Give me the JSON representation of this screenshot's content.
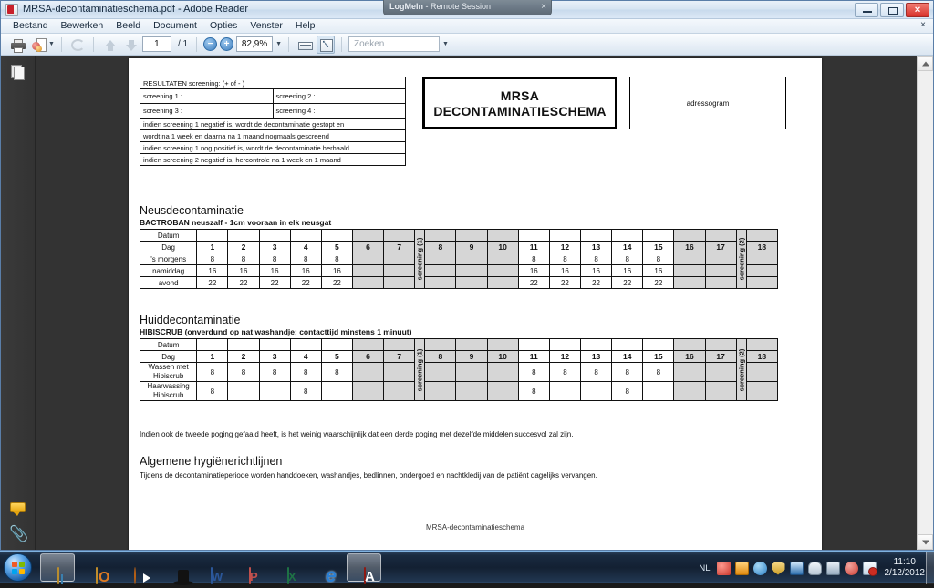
{
  "logmein": {
    "app": "LogMeIn",
    "suffix": " - Remote Session",
    "close": "×"
  },
  "window": {
    "title": "MRSA-decontaminatieschema.pdf - Adobe Reader",
    "minimize_label": "Minimaliseren",
    "maximize_label": "Maximaliseren",
    "close_label": "Sluiten"
  },
  "menubar": {
    "items": [
      "Bestand",
      "Bewerken",
      "Beeld",
      "Document",
      "Opties",
      "Venster",
      "Help"
    ],
    "close_doc": "×"
  },
  "toolbar": {
    "print_label": "Afdrukken",
    "share_label": "Verzenden",
    "rotate_label": "Draaien",
    "prev_label": "Vorige pagina",
    "next_label": "Volgende pagina",
    "page_current": "1",
    "page_total": "/ 1",
    "zoom_out": "−",
    "zoom_in": "+",
    "zoom_value": "82,9%",
    "zoom_caret": "▼",
    "fit_width_label": "Paginabreedte",
    "fit_page_label": "Volledige pagina",
    "search_placeholder": "Zoeken",
    "search_value": "",
    "search_caret": "▼"
  },
  "navrail": {
    "pages_label": "Paginaminiaturen",
    "comments_label": "Opmerkingen",
    "attachments_label": "Bijlagen",
    "clip_glyph": "📎"
  },
  "scrollbar": {
    "up": "▲",
    "down": "▼"
  },
  "document": {
    "results_table": {
      "title": "RESULTATEN screening: (+ of - )",
      "rows": [
        [
          "screening 1    :",
          "screening 2    :"
        ],
        [
          "screening 3    :",
          "screening 4    :"
        ]
      ],
      "notes": [
        "indien screening 1 negatief  is, wordt de decontaminatie gestopt en",
        "wordt na 1 week en daarna na 1 maand nogmaals gescreend",
        "indien screening 1 nog positief  is, wordt de decontaminatie herhaald",
        "indien screening 2 negatief is, hercontrole na 1 week en 1 maand"
      ]
    },
    "title_box": {
      "line1": "MRSA",
      "line2": "DECONTAMINATIESCHEMA"
    },
    "address_box": {
      "label": "adressogram"
    },
    "section_nose": {
      "heading": "Neusdecontaminatie",
      "subheading": "BACTROBAN neuszalf - 1cm vooraan in elk neusgat",
      "row_labels": {
        "datum": "Datum",
        "dag": "Dag",
        "r1": "'s morgens",
        "r2": "namiddag",
        "r3": "avond"
      },
      "screening1": "screening (1)",
      "screening2": "screening (2)"
    },
    "section_skin": {
      "heading": "Huiddecontaminatie",
      "subheading": "HIBISCRUB (onverdund op nat washandje; contacttijd minstens 1 minuut)",
      "row_labels": {
        "datum": "Datum",
        "dag": "Dag",
        "r1_line1": "Wassen met",
        "r1_line2": "Hibiscrub",
        "r2_line1": "Haarwassing",
        "r2_line2": "Hibiscrub"
      },
      "screening1": "screening (1)",
      "screening2": "screening (2)"
    },
    "note_third_attempt": "Indien ook de tweede poging gefaald heeft, is het weinig waarschijnlijk dat een derde poging met dezelfde middelen succesvol zal zijn.",
    "section_hygiene": {
      "heading": "Algemene hygiënerichtlijnen",
      "text": "Tijdens de decontaminatieperiode worden handdoeken, washandjes, bedlinnen, ondergoed en nachtkledij van de patiënt dagelijks vervangen."
    },
    "footer": "MRSA-decontaminatieschema"
  },
  "schedule": {
    "days": [
      "1",
      "2",
      "3",
      "4",
      "5",
      "6",
      "7",
      "8",
      "9",
      "10",
      "11",
      "12",
      "13",
      "14",
      "15",
      "16",
      "17",
      "18"
    ],
    "shaded_days": [
      "6",
      "7",
      "8",
      "9",
      "10",
      "16",
      "17",
      "18"
    ],
    "screening1_after": "7",
    "screening2_after": "17",
    "nose": {
      "morning": {
        "1": "8",
        "2": "8",
        "3": "8",
        "4": "8",
        "5": "8",
        "11": "8",
        "12": "8",
        "13": "8",
        "14": "8",
        "15": "8"
      },
      "afternoon": {
        "1": "16",
        "2": "16",
        "3": "16",
        "4": "16",
        "5": "16",
        "11": "16",
        "12": "16",
        "13": "16",
        "14": "16",
        "15": "16"
      },
      "evening": {
        "1": "22",
        "2": "22",
        "3": "22",
        "4": "22",
        "5": "22",
        "11": "22",
        "12": "22",
        "13": "22",
        "14": "22",
        "15": "22"
      }
    },
    "skin": {
      "wash": {
        "1": "8",
        "2": "8",
        "3": "8",
        "4": "8",
        "5": "8",
        "11": "8",
        "12": "8",
        "13": "8",
        "14": "8",
        "15": "8"
      },
      "hair": {
        "1": "8",
        "4": "8",
        "11": "8",
        "14": "8"
      }
    }
  },
  "taskbar": {
    "start_label": "Start",
    "items": [
      {
        "name": "explorer",
        "label": "Windows Verkenner",
        "active": true
      },
      {
        "name": "outlook",
        "label": "Microsoft Outlook",
        "active": false
      },
      {
        "name": "media-player",
        "label": "Windows Media Player",
        "active": false
      },
      {
        "name": "hat-app",
        "label": "Toepassing",
        "active": false
      },
      {
        "name": "word",
        "label": "Microsoft Word",
        "active": false
      },
      {
        "name": "powerpoint",
        "label": "Microsoft PowerPoint",
        "active": false
      },
      {
        "name": "excel",
        "label": "Microsoft Excel",
        "active": false
      },
      {
        "name": "internet-explorer",
        "label": "Internet Explorer",
        "active": false
      },
      {
        "name": "adobe-reader",
        "label": "Adobe Reader",
        "active": true
      }
    ],
    "tray": {
      "language": "NL",
      "icons": [
        "red-app-icon",
        "orange-app-icon",
        "blue-globe-icon",
        "shield-icon",
        "network-icon",
        "mouse-icon",
        "display-icon",
        "volume-muted-icon",
        "flag-alert-icon"
      ]
    },
    "clock": {
      "time": "11:10",
      "date": "2/12/2012"
    }
  },
  "colors": {
    "accent": "#2b579a",
    "shade": "#d6d6d6",
    "page": "#ffffff",
    "taskbar": "#16263a"
  }
}
